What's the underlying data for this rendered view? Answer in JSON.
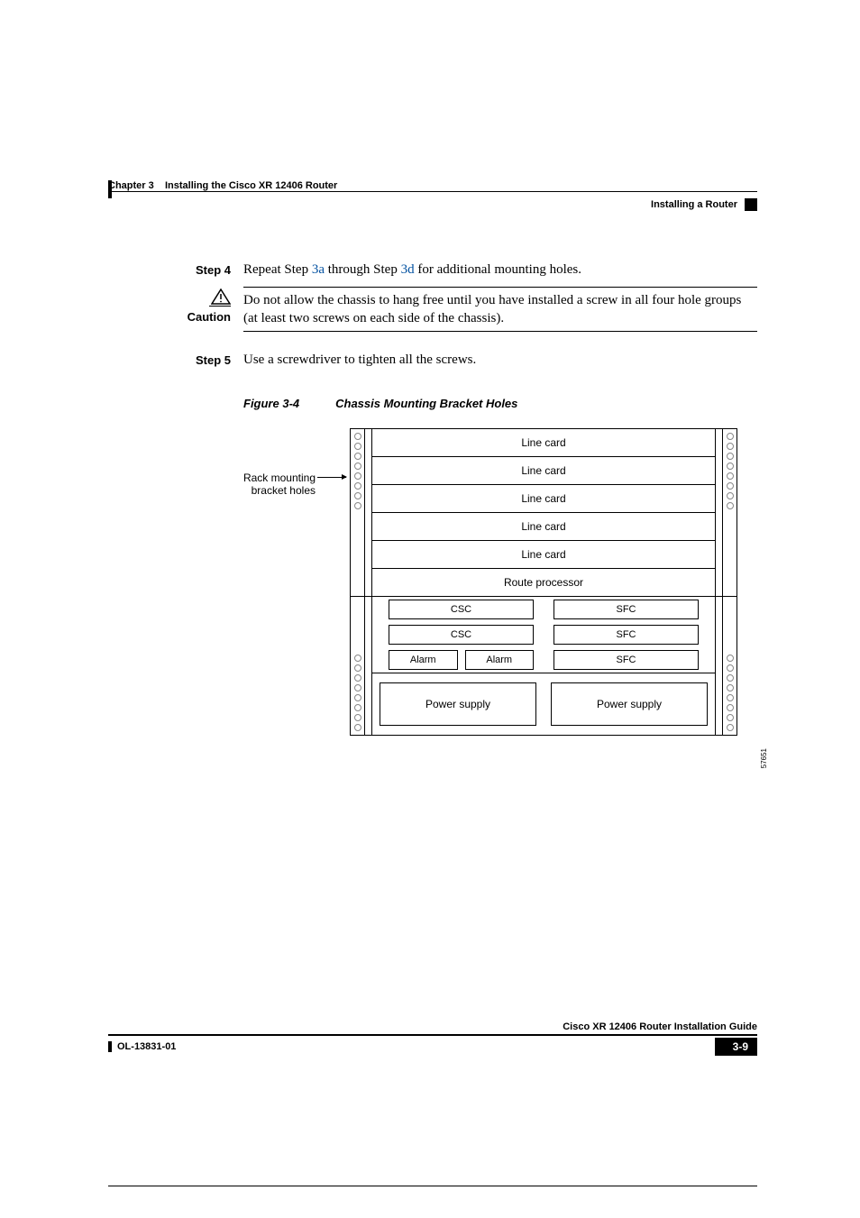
{
  "header": {
    "chapter": "Chapter 3",
    "chapterTitle": "Installing the Cisco XR 12406 Router",
    "section": "Installing a Router"
  },
  "steps": {
    "step4": {
      "label": "Step 4",
      "pre": "Repeat Step ",
      "linkA": "3a",
      "mid": " through Step ",
      "linkB": "3d",
      "post": " for additional mounting holes."
    },
    "caution": {
      "label": "Caution",
      "text": "Do not allow the chassis to hang free until you have installed a screw in all four hole groups (at least two screws on each side of the chassis)."
    },
    "step5": {
      "label": "Step 5",
      "text": "Use a screwdriver to tighten all the screws."
    }
  },
  "figure": {
    "label": "Figure 3-4",
    "title": "Chassis Mounting Bracket Holes",
    "callout1": "Rack mounting",
    "callout2": "bracket holes",
    "linecard": "Line card",
    "rp": "Route processor",
    "csc": "CSC",
    "sfc": "SFC",
    "alarm": "Alarm",
    "ps": "Power supply",
    "id": "57651"
  },
  "footer": {
    "guide": "Cisco XR 12406 Router Installation Guide",
    "doc": "OL-13831-01",
    "page": "3-9"
  }
}
